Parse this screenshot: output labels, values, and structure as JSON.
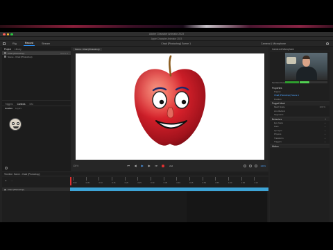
{
  "window": {
    "title": "Adobe Character Animator 2023",
    "subtitle": "Apple Character Animator 2023"
  },
  "menubar": {
    "tabs": [
      "Rig",
      "Record",
      "Stream"
    ],
    "active_tab": "Record",
    "doc_title": "Chad [Photoshop] Scene 1",
    "right_label": "Camera & Microphone"
  },
  "left_panel": {
    "tabs": [
      "Project",
      "Library"
    ],
    "puppets": [
      {
        "name": "Chad (Photoshop)",
        "value": "Scene 1",
        "selected": true
      },
      {
        "name": "Scene - Chad (Photoshop)",
        "value": "",
        "selected": false
      }
    ],
    "lower_tabs": [
      "Triggers",
      "Controls",
      "Info"
    ],
    "sub_tabs": [
      "Handles",
      "Layers"
    ]
  },
  "center": {
    "tab_label": "Scene - Chad (Photoshop)",
    "zoom": "100%",
    "frame_label": "Frame"
  },
  "transport": {
    "frame": "24d"
  },
  "right_panel": {
    "header": "Camera & Microphone",
    "camera_labels": {
      "left": "Set Rest Pose",
      "right": "Mic"
    },
    "properties_title": "Properties",
    "puppet_label": "Puppet",
    "puppet_name": "Chad [Photoshop] Scene 1",
    "position_label": "Position",
    "triggers_title": "Puppet Mesh",
    "rows": [
      {
        "label": "Mesh Scale",
        "value": "100 %"
      },
      {
        "label": "Arm Behind",
        "value": ""
      },
      {
        "label": "Segments",
        "value": ""
      }
    ],
    "behaviors_title": "Behaviors",
    "behaviors": [
      {
        "label": "Eye Gaze"
      },
      {
        "label": "Face"
      },
      {
        "label": "Lip Sync"
      },
      {
        "label": "Physics"
      },
      {
        "label": "Transform"
      },
      {
        "label": "Triggers"
      }
    ],
    "bottom_title": "Motion"
  },
  "timeline": {
    "title": "Timeline: Scene - Chad (Photoshop)",
    "ruler_ticks": [
      "0:00",
      "0:05",
      "0:10",
      "0:15",
      "0:20",
      "0:25",
      "0:30",
      "0:35",
      "0:40",
      "0:45",
      "0:50",
      "0:55",
      "1:00",
      "1:05",
      "1:10"
    ],
    "track_label": "Chad (Photoshop)"
  },
  "colors": {
    "accent": "#2b8df0",
    "track": "#3da4d6",
    "playhead": "#e03131",
    "apple_red": "#d4202a"
  }
}
